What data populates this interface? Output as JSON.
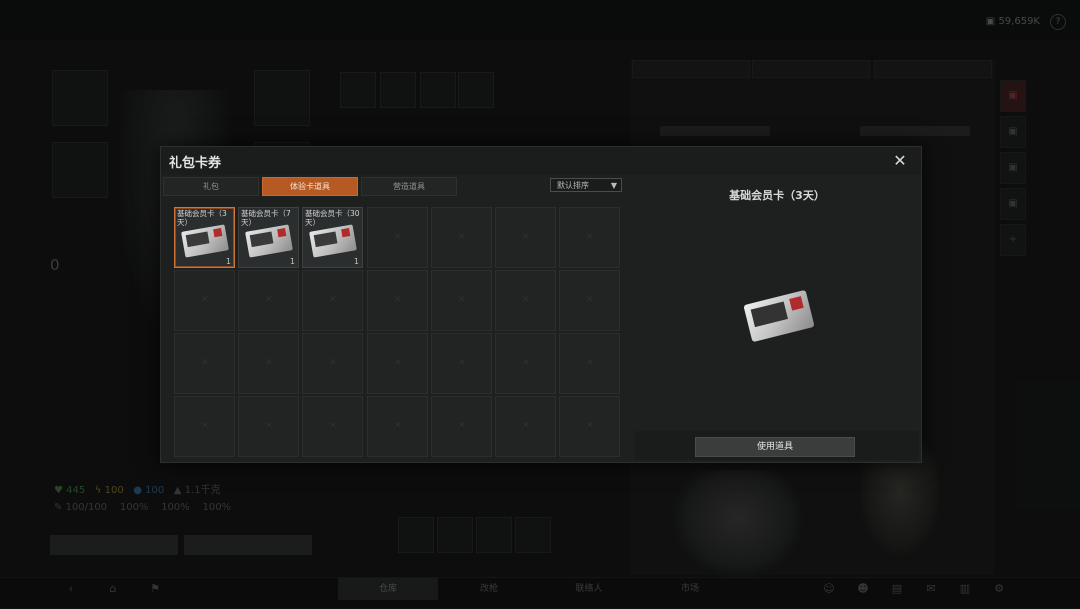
{
  "header": {
    "currency_value": "59,659K",
    "help_label": "?"
  },
  "bottom_nav": {
    "tabs": [
      "仓库",
      "改枪",
      "联络人",
      "市场"
    ]
  },
  "stats": {
    "health": "445",
    "stamina": "100",
    "water": "100",
    "weight": "1.1千克",
    "armor": "100/100",
    "pct1": "100%",
    "pct2": "100%",
    "pct3": "100%",
    "zero": "0"
  },
  "modal": {
    "title": "礼包卡券",
    "close_label": "✕",
    "tabs": [
      {
        "label": "礼包",
        "active": false
      },
      {
        "label": "体验卡道具",
        "active": true
      },
      {
        "label": "营造道具",
        "active": false
      }
    ],
    "sort": {
      "label": "默认排序"
    },
    "items": [
      {
        "name": "基础会员卡（3天）",
        "qty": "1",
        "selected": true
      },
      {
        "name": "基础会员卡（7天）",
        "qty": "1",
        "selected": false
      },
      {
        "name": "基础会员卡（30天）",
        "qty": "1",
        "selected": false
      }
    ],
    "detail": {
      "title": "基础会员卡（3天）",
      "use_button": "使用道具"
    }
  },
  "colors": {
    "accent": "#b65a24",
    "modal_bg": "#1e2020",
    "page_bg": "#141515"
  }
}
